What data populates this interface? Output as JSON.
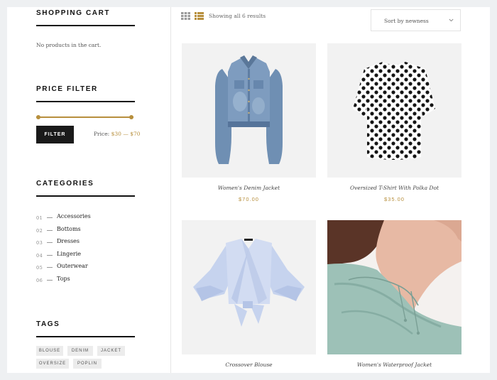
{
  "sidebar": {
    "shopping_cart": {
      "title": "SHOPPING CART",
      "empty_message": "No products in the cart."
    },
    "price_filter": {
      "title": "PRICE FILTER",
      "button_label": "FILTER",
      "price_label": "Price:",
      "min": "$30",
      "separator": "—",
      "max": "$70",
      "range_min_fraction": 0.0,
      "range_max_fraction": 1.0
    },
    "categories": {
      "title": "CATEGORIES",
      "items": [
        {
          "num": "01",
          "label": "Accessories"
        },
        {
          "num": "02",
          "label": "Bottoms"
        },
        {
          "num": "03",
          "label": "Dresses"
        },
        {
          "num": "04",
          "label": "Lingerie"
        },
        {
          "num": "05",
          "label": "Outerwear"
        },
        {
          "num": "06",
          "label": "Tops"
        }
      ]
    },
    "tags": {
      "title": "TAGS",
      "items": [
        "BLOUSE",
        "DENIM",
        "JACKET",
        "OVERSIZE",
        "POPLIN"
      ]
    }
  },
  "toolbar": {
    "results_text": "Showing all 6 results",
    "sort_label": "Sort by newness",
    "view_modes": [
      "grid-icon",
      "list-icon"
    ],
    "active_view": "list"
  },
  "products": [
    {
      "name": "Women's Denim Jacket",
      "price": "$70.00"
    },
    {
      "name": "Oversized T-Shirt With Polka Dot",
      "price": "$35.00"
    },
    {
      "name": "Crossover Blouse",
      "price": ""
    },
    {
      "name": "Women's Waterproof Jacket",
      "price": ""
    }
  ],
  "colors": {
    "accent_gold": "#b78f3d",
    "dark": "#1a1a1a",
    "background": "#eef0f2"
  }
}
